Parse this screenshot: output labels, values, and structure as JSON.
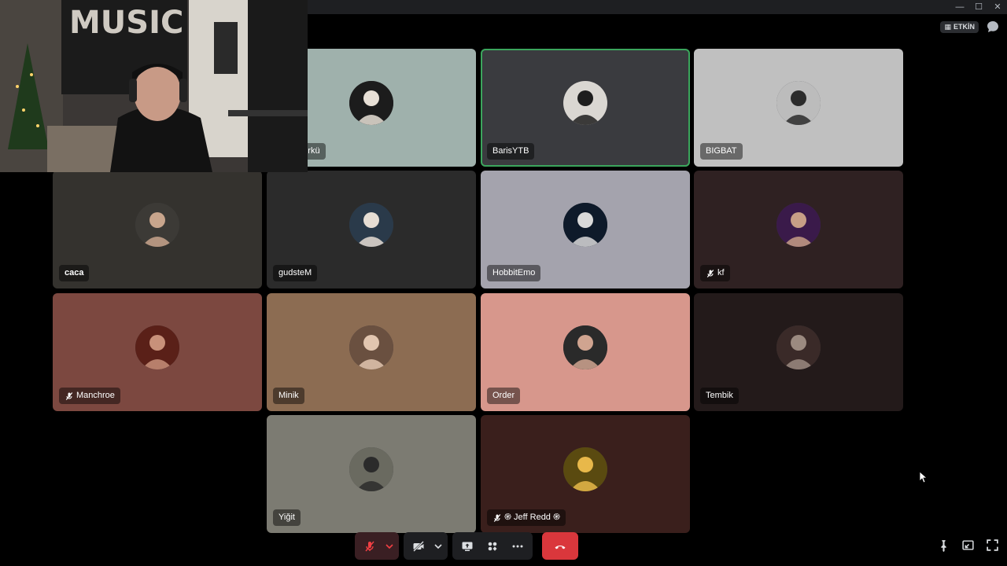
{
  "window": {
    "controls": [
      "minimize",
      "maximize",
      "close"
    ]
  },
  "header": {
    "event_label": "ETKİN"
  },
  "participants": [
    {
      "name": "hmetTürkü",
      "tile_color": "#9fb1ac",
      "muted": false,
      "speaking": false
    },
    {
      "name": "BarisYTB",
      "tile_color": "#3a3b3f",
      "muted": false,
      "speaking": true
    },
    {
      "name": "BIGBAT",
      "tile_color": "#c0c0c0",
      "muted": false,
      "speaking": false
    },
    {
      "name": "caca",
      "tile_color": "#34322e",
      "muted": false,
      "speaking": false
    },
    {
      "name": "gudsteM",
      "tile_color": "#2b2b2b",
      "muted": false,
      "speaking": false
    },
    {
      "name": "HobbitEmo",
      "tile_color": "#a4a3ad",
      "muted": false,
      "speaking": false
    },
    {
      "name": "kf",
      "tile_color": "#2f2122",
      "muted": true,
      "speaking": false
    },
    {
      "name": "Manchroe",
      "tile_color": "#7c4840",
      "muted": true,
      "speaking": false
    },
    {
      "name": "Minik",
      "tile_color": "#8c6c52",
      "muted": false,
      "speaking": false
    },
    {
      "name": "Order",
      "tile_color": "#d7978c",
      "muted": false,
      "speaking": false
    },
    {
      "name": "Tembik",
      "tile_color": "#231a1a",
      "muted": false,
      "speaking": false
    },
    {
      "name": "Yiğit",
      "tile_color": "#7c7b72",
      "muted": false,
      "speaking": false
    },
    {
      "name": "֍ Jeff Redd ֍",
      "tile_color": "#3a1f1c",
      "muted": true,
      "speaking": false
    }
  ],
  "webcam": {
    "poster_text": "MUSIC IS MY DRE"
  },
  "controls": {
    "mic_state": "muted",
    "camera_state": "off",
    "buttons": [
      "mic",
      "mic-options",
      "camera",
      "camera-options",
      "screen-share",
      "activities",
      "more",
      "disconnect"
    ]
  },
  "colors": {
    "speaking_border": "#3ba55c",
    "hangup": "#da373c",
    "muted_red": "#f23f43"
  }
}
